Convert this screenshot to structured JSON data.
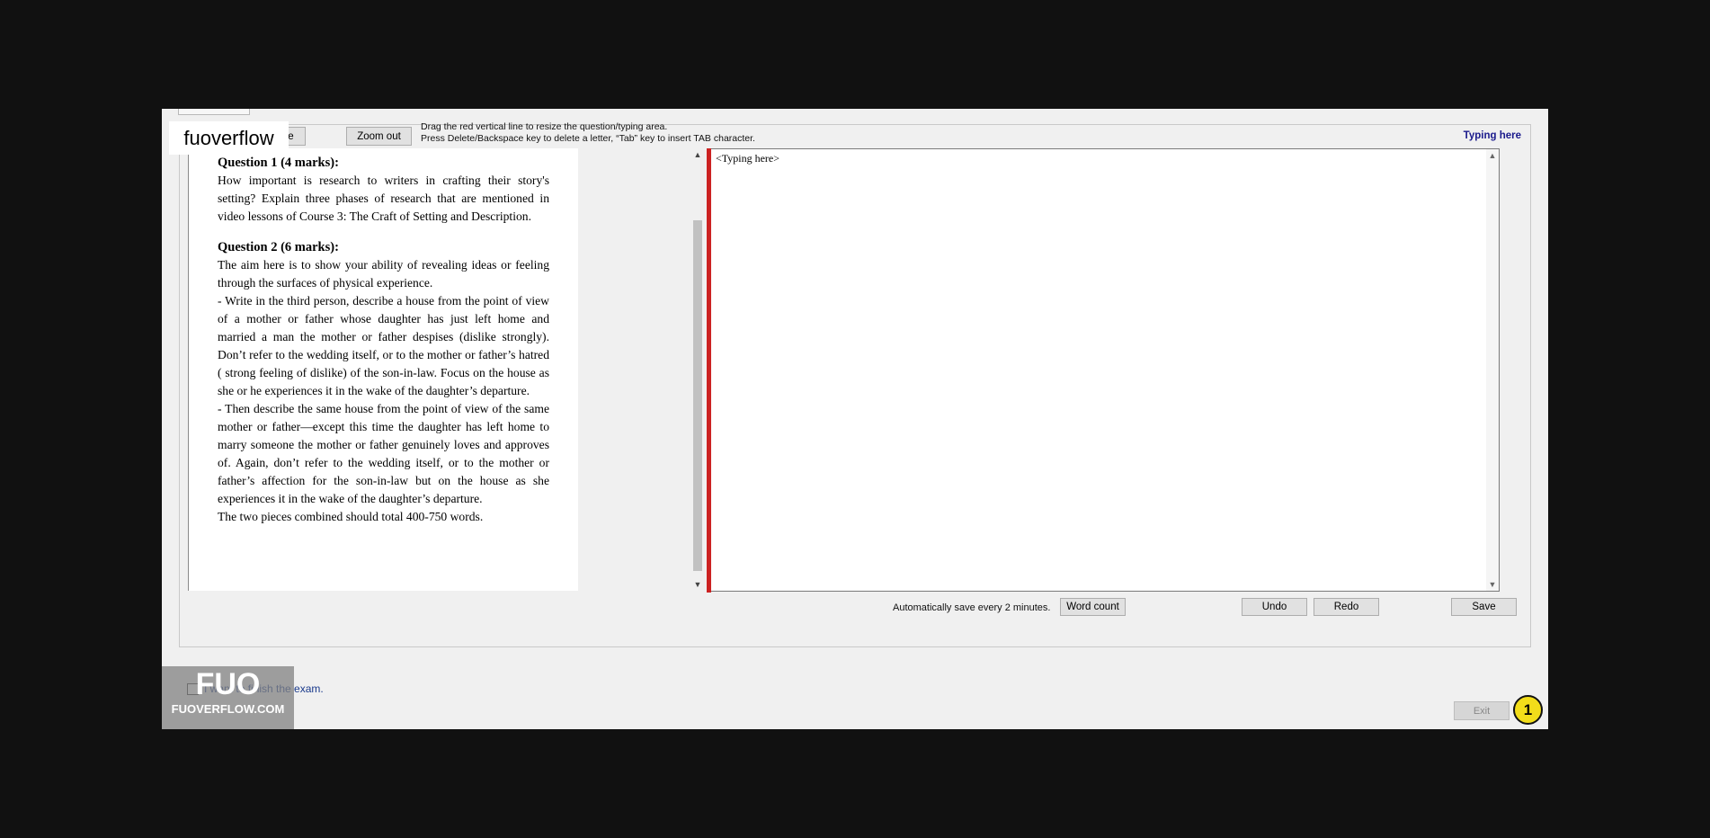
{
  "toolbar": {
    "original_size_label": "Original size",
    "zoom_out_label": "Zoom out",
    "hint_line1": "Drag the red vertical line to resize the question/typing area.",
    "hint_line2": "Press Delete/Backspace key to delete a letter, “Tab” key to insert TAB character.",
    "typing_title": "Typing here"
  },
  "questions": {
    "q1_heading": "Question 1 (4 marks):",
    "q1_body": "How important is research to writers in crafting their story's setting? Explain three phases of research that are mentioned in video lessons of Course 3: The Craft of Setting and Description.",
    "q2_heading": "Question 2 (6 marks):",
    "q2_intro": "The aim here is to show your ability of revealing ideas or feeling through the surfaces of physical experience.",
    "q2_part1": "- Write in the third person, describe a house from the point of view of a mother or father whose daughter has just left home and married a man the mother or father despises (dislike strongly). Don’t refer to the wedding itself, or to the mother or father’s hatred ( strong feeling of dislike) of the son-in-law. Focus on the house as she or he experiences it in the wake of the daughter’s departure.",
    "q2_part2": "- Then describe the same house from the point of view of the same mother or father—except this time the daughter has left home to marry someone the mother or father genuinely loves and approves of. Again, don’t refer to the wedding itself, or to the mother or father’s affection for the son-in-law but on the house as she experiences it in the wake of the daughter’s departure.",
    "q2_total": "The two pieces combined should total 400-750 words."
  },
  "editor": {
    "placeholder_text": "<Typing here>"
  },
  "footer": {
    "autosave_text": "Automatically save every 2 minutes.",
    "word_count_label": "Word count",
    "undo_label": "Undo",
    "redo_label": "Redo",
    "save_label": "Save",
    "finish_label": "I want to finish the exam.",
    "exit_label": "Exit"
  },
  "watermarks": {
    "top_left": "fuoverflow",
    "bottom_left_logo": "FUO",
    "bottom_left_site": "FUOVERFLOW.COM"
  },
  "badge": {
    "number": "1",
    "color": "#f2dd1a"
  },
  "colors": {
    "splitter": "#cc2222",
    "title_blue": "#1a1a8c"
  },
  "icons": {
    "scroll_up": "chevron-up-icon",
    "scroll_down": "chevron-down-icon"
  }
}
